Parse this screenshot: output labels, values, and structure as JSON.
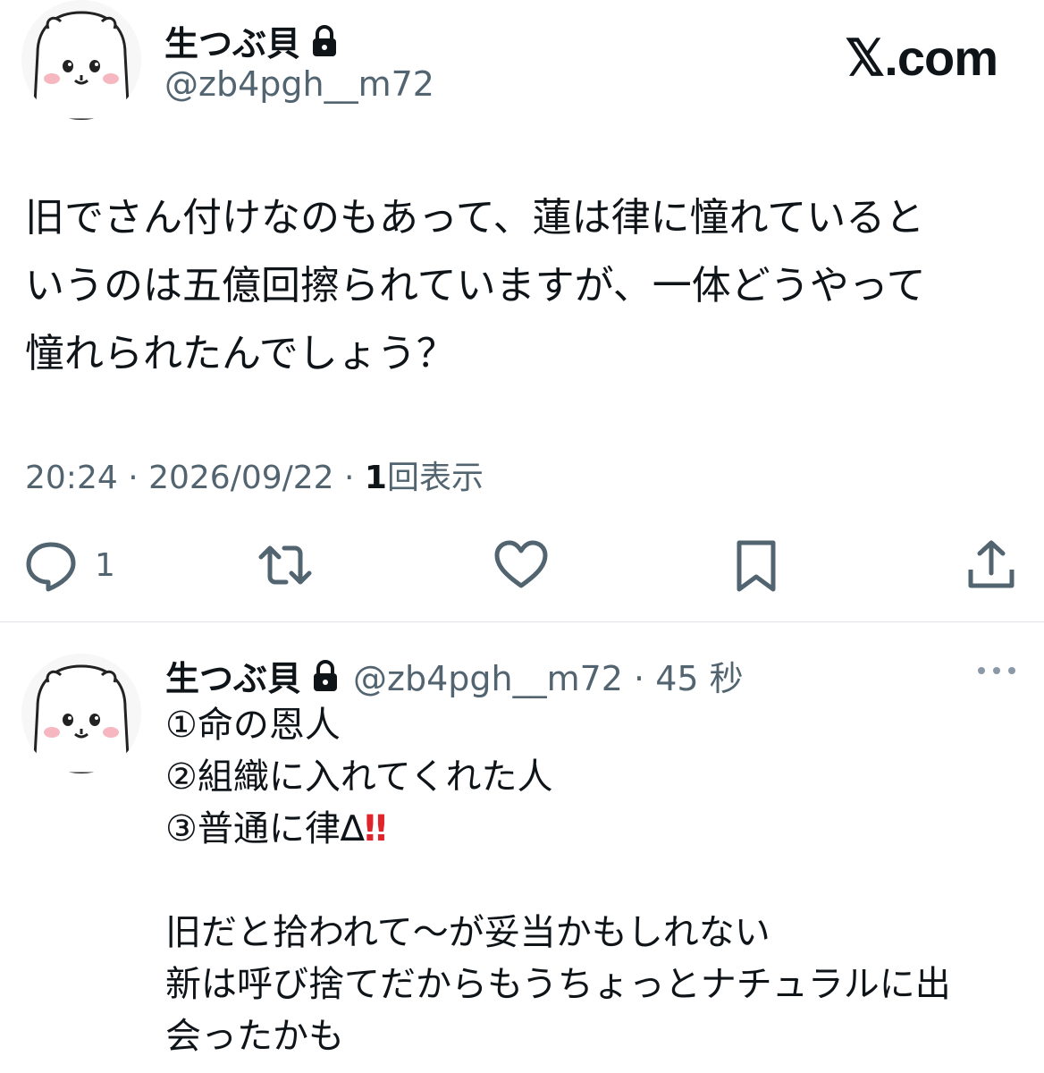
{
  "brand": "𝕏.com",
  "main_tweet": {
    "author": {
      "name": "生つぶ貝",
      "handle": "@zb4pgh__m72",
      "protected": true
    },
    "lines": [
      "旧でさん付けなのもあって、蓮は律に憧れていると",
      "いうのは五億回擦られていますが、一体どうやって",
      "憧れられたんでしょう？"
    ],
    "time": "20:24 · 2026/09/22 · ",
    "views_count": "1",
    "views_label": "回表示",
    "actions": {
      "reply_count": "1",
      "icons": [
        "reply-icon",
        "retweet-icon",
        "like-icon",
        "bookmark-icon",
        "share-icon"
      ]
    }
  },
  "reply": {
    "author": {
      "name": "生つぶ貝",
      "handle_time": "@zb4pgh__m72 · 45 秒",
      "protected": true
    },
    "lines": [
      "①命の恩人",
      "②組織に入れてくれた人",
      "③普通に律∆",
      "",
      "旧だと拾われて〜が妥当かもしれない",
      "新は呼び捨てだからもうちょっとナチュラルに出",
      "会ったかも"
    ],
    "line3_emoji": "‼"
  },
  "colors": {
    "text": "#0f1419",
    "secondary": "#536471",
    "divider": "#dfe3e7",
    "emoji_red": "#e0242b"
  }
}
